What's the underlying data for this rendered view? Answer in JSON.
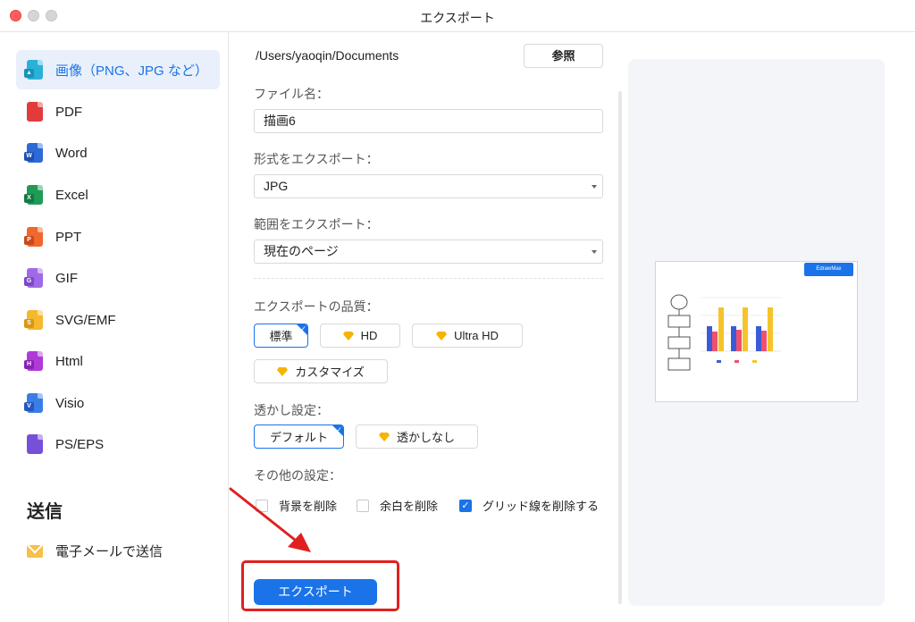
{
  "window": {
    "title": "エクスポート"
  },
  "sidebar": {
    "items": [
      {
        "label": "画像（PNG、JPG など）",
        "icon": "image-icon",
        "color": "#2bb1d8"
      },
      {
        "label": "PDF",
        "icon": "pdf-file-icon",
        "color": "#e23b3b"
      },
      {
        "label": "Word",
        "icon": "word-file-icon",
        "color": "#2d6ad8"
      },
      {
        "label": "Excel",
        "icon": "excel-file-icon",
        "color": "#1f9b56"
      },
      {
        "label": "PPT",
        "icon": "ppt-file-icon",
        "color": "#f0682d"
      },
      {
        "label": "GIF",
        "icon": "gif-file-icon",
        "color": "#a06ae6"
      },
      {
        "label": "SVG/EMF",
        "icon": "svg-file-icon",
        "color": "#f5b82e"
      },
      {
        "label": "Html",
        "icon": "html-file-icon",
        "color": "#b03ad8"
      },
      {
        "label": "Visio",
        "icon": "visio-file-icon",
        "color": "#3b7de6"
      },
      {
        "label": "PS/EPS",
        "icon": "ps-file-icon",
        "color": "#7650d8"
      }
    ],
    "send_title": "送信",
    "email_label": "電子メールで送信"
  },
  "form": {
    "path": "/Users/yaoqin/Documents",
    "browse_label": "参照",
    "filename_label": "ファイル名：",
    "filename_value": "描画6",
    "format_label": "形式をエクスポート：",
    "format_value": "JPG",
    "range_label": "範囲をエクスポート：",
    "range_value": "現在のページ",
    "quality_label": "エクスポートの品質：",
    "quality_options": [
      "標準",
      "HD",
      "Ultra HD",
      "カスタマイズ"
    ],
    "watermark_label": "透かし設定：",
    "watermark_options": [
      "デフォルト",
      "透かしなし"
    ],
    "other_label": "その他の設定：",
    "checkboxes": [
      {
        "label": "背景を削除",
        "checked": false
      },
      {
        "label": "余白を削除",
        "checked": false
      },
      {
        "label": "グリッド線を削除する",
        "checked": true
      }
    ],
    "export_label": "エクスポート"
  },
  "preview": {
    "brand": "EdrawMax"
  },
  "colors": {
    "accent": "#1a73e8",
    "highlight": "#e02020"
  }
}
